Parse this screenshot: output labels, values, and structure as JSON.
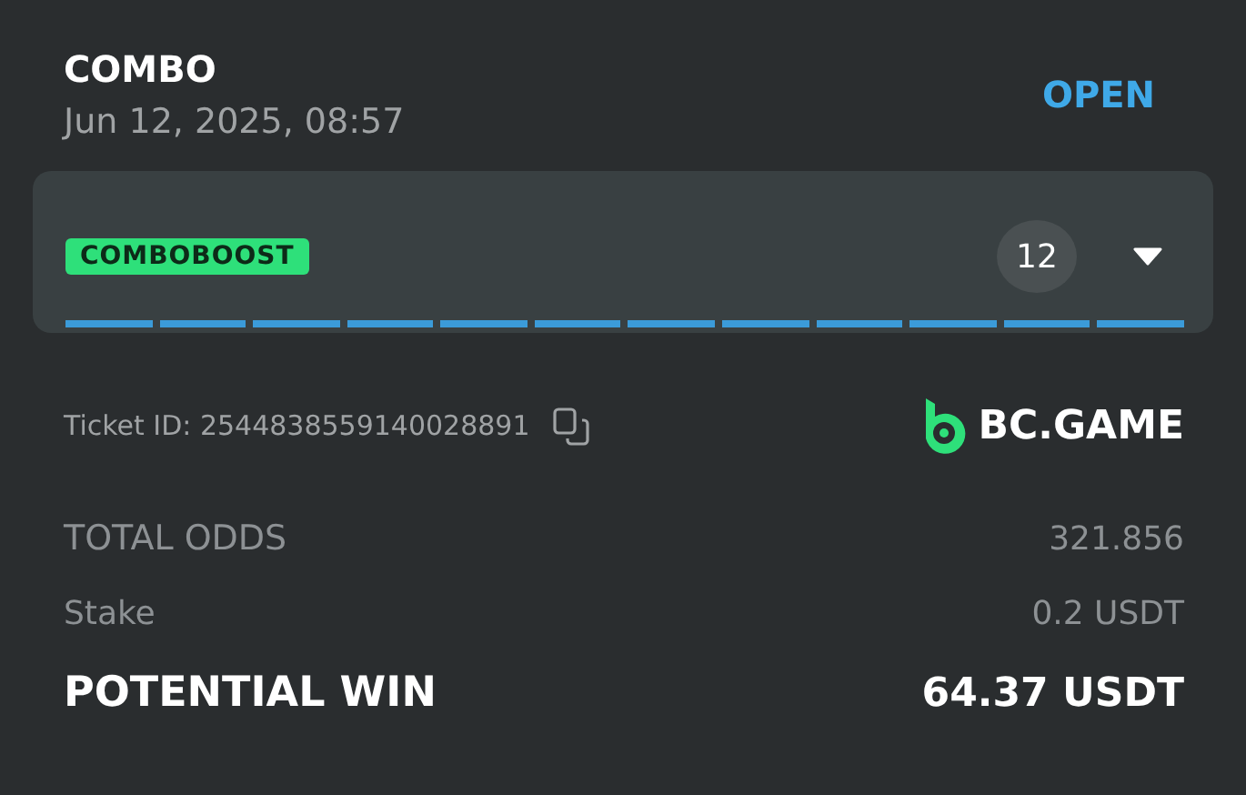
{
  "header": {
    "title": "COMBO",
    "date": "Jun 12, 2025, 08:57",
    "status": "OPEN"
  },
  "combo": {
    "badge": "COMBOBOOST",
    "count": "12",
    "expanded": false,
    "legs": [
      {
        "done": true
      },
      {
        "done": true
      },
      {
        "done": true
      },
      {
        "done": true
      },
      {
        "done": true
      },
      {
        "done": true
      },
      {
        "done": true
      },
      {
        "done": true
      },
      {
        "done": true
      },
      {
        "done": true
      },
      {
        "done": true
      },
      {
        "done": true
      }
    ]
  },
  "ticket": {
    "label": "Ticket ID: 2544838559140028891",
    "brand": "BC.GAME"
  },
  "summary": [
    {
      "kind": "muted",
      "label": "TOTAL ODDS",
      "value": "321.856"
    },
    {
      "kind": "small",
      "label": "Stake",
      "value": "0.2 USDT"
    },
    {
      "kind": "strong",
      "label": "POTENTIAL WIN",
      "value": "64.37 USDT"
    }
  ]
}
